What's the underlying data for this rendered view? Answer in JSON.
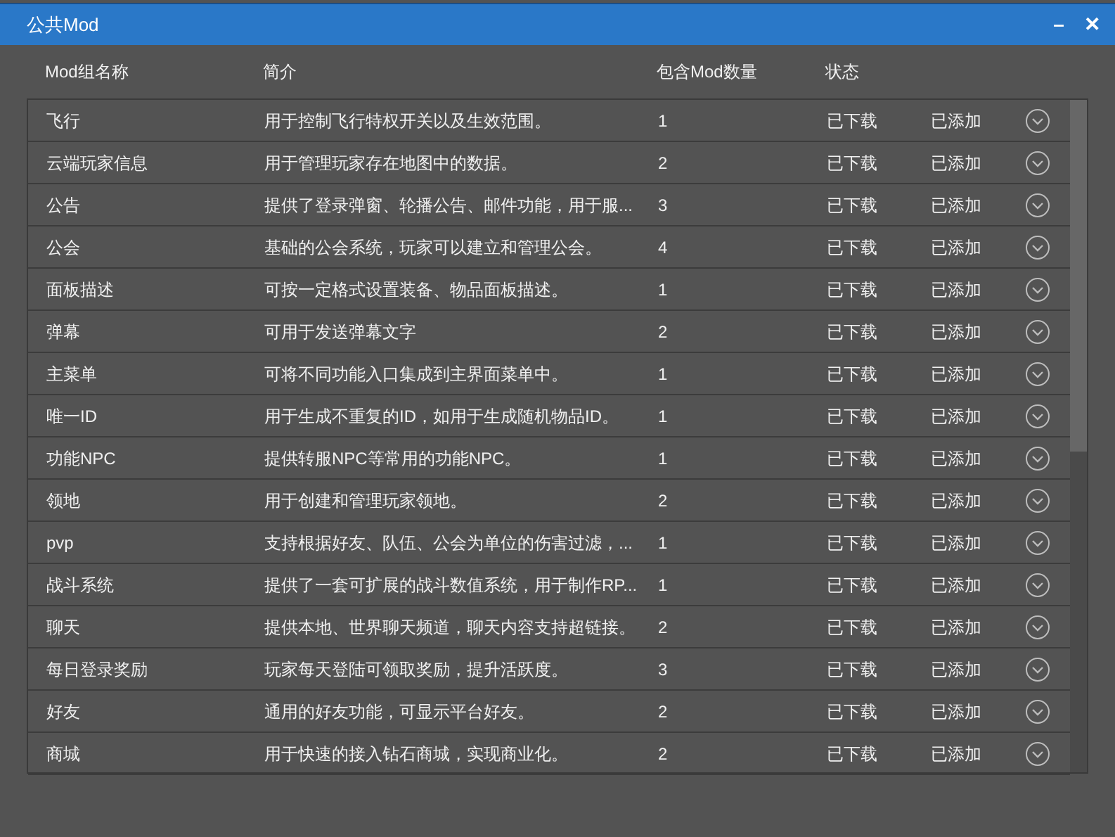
{
  "window": {
    "title": "公共Mod",
    "controls": [
      "–",
      "✕"
    ]
  },
  "table": {
    "columns": [
      "Mod组名称",
      "简介",
      "包含Mod数量",
      "状态"
    ],
    "rows": [
      {
        "name": "飞行",
        "description": "用于控制飞行特权开关以及生效范围。",
        "count": "1",
        "download": "已下载",
        "added": "已添加"
      },
      {
        "name": "云端玩家信息",
        "description": "用于管理玩家存在地图中的数据。",
        "count": "2",
        "download": "已下载",
        "added": "已添加"
      },
      {
        "name": "公告",
        "description": "提供了登录弹窗、轮播公告、邮件功能，用于服...",
        "count": "3",
        "download": "已下载",
        "added": "已添加"
      },
      {
        "name": "公会",
        "description": "基础的公会系统，玩家可以建立和管理公会。",
        "count": "4",
        "download": "已下载",
        "added": "已添加"
      },
      {
        "name": "面板描述",
        "description": "可按一定格式设置装备、物品面板描述。",
        "count": "1",
        "download": "已下载",
        "added": "已添加"
      },
      {
        "name": "弹幕",
        "description": "可用于发送弹幕文字",
        "count": "2",
        "download": "已下载",
        "added": "已添加"
      },
      {
        "name": "主菜单",
        "description": "可将不同功能入口集成到主界面菜单中。",
        "count": "1",
        "download": "已下载",
        "added": "已添加"
      },
      {
        "name": "唯一ID",
        "description": "用于生成不重复的ID，如用于生成随机物品ID。",
        "count": "1",
        "download": "已下载",
        "added": "已添加"
      },
      {
        "name": "功能NPC",
        "description": "提供转服NPC等常用的功能NPC。",
        "count": "1",
        "download": "已下载",
        "added": "已添加"
      },
      {
        "name": "领地",
        "description": "用于创建和管理玩家领地。",
        "count": "2",
        "download": "已下载",
        "added": "已添加"
      },
      {
        "name": "pvp",
        "description": "支持根据好友、队伍、公会为单位的伤害过滤，...",
        "count": "1",
        "download": "已下载",
        "added": "已添加"
      },
      {
        "name": "战斗系统",
        "description": "提供了一套可扩展的战斗数值系统，用于制作RP...",
        "count": "1",
        "download": "已下载",
        "added": "已添加"
      },
      {
        "name": "聊天",
        "description": "提供本地、世界聊天频道，聊天内容支持超链接。",
        "count": "2",
        "download": "已下载",
        "added": "已添加"
      },
      {
        "name": "每日登录奖励",
        "description": "玩家每天登陆可领取奖励，提升活跃度。",
        "count": "3",
        "download": "已下载",
        "added": "已添加"
      },
      {
        "name": "好友",
        "description": "通用的好友功能，可显示平台好友。",
        "count": "2",
        "download": "已下载",
        "added": "已添加"
      },
      {
        "name": "商城",
        "description": "用于快速的接入钻石商城，实现商业化。",
        "count": "2",
        "download": "已下载",
        "added": "已添加"
      }
    ]
  }
}
